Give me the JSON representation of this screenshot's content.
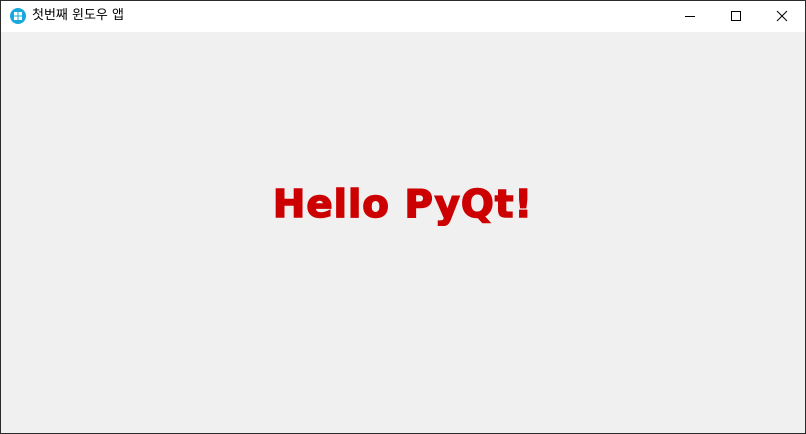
{
  "window": {
    "title": "첫번째 윈도우 앱",
    "icon": "app-window-icon",
    "controls": {
      "minimize_icon": "minimize-icon",
      "maximize_icon": "maximize-icon",
      "close_icon": "close-icon"
    }
  },
  "main": {
    "label_text": "Hello PyQt!",
    "label_color": "#cc0000"
  },
  "colors": {
    "client_background": "#f0f0f0",
    "titlebar_background": "#ffffff",
    "app_icon": "#1aa7dc"
  }
}
